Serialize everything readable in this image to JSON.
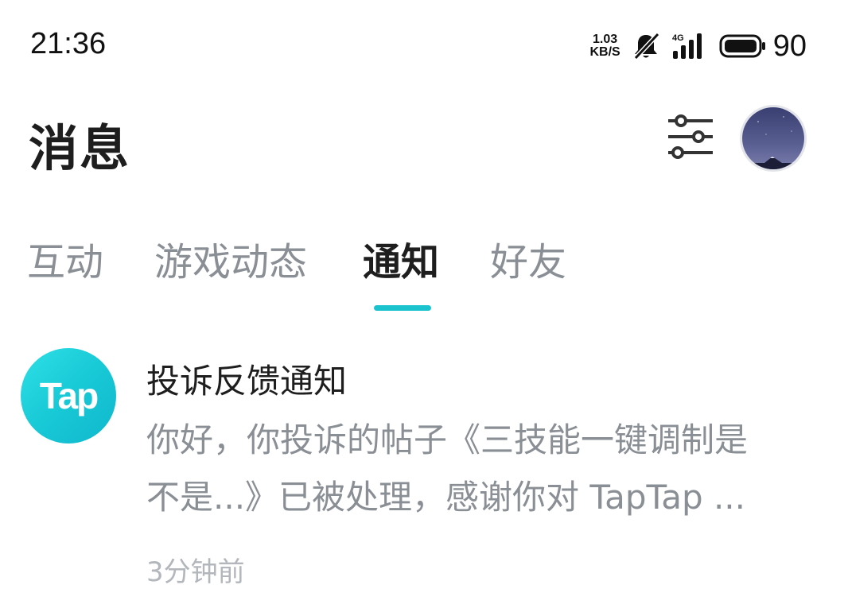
{
  "status_bar": {
    "time": "21:36",
    "net_speed_value": "1.03",
    "net_speed_unit": "KB/S",
    "network_type": "4G",
    "battery_level": "90",
    "icons": [
      "bell-muted-icon",
      "signal-icon",
      "battery-icon"
    ]
  },
  "header": {
    "title": "消息",
    "filter_icon": "sliders-icon",
    "avatar_icon": "user-avatar"
  },
  "tabs": {
    "items": [
      {
        "label": "互动"
      },
      {
        "label": "游戏动态"
      },
      {
        "label": "通知"
      },
      {
        "label": "好友"
      }
    ],
    "active_index": 2,
    "accent_color": "#1bc3cf"
  },
  "notifications": [
    {
      "sender_logo_text": "Tap",
      "title": "投诉反馈通知",
      "body_line_1": "你好，你投诉的帖子《三技能一键调制是",
      "body_line_2": "不是...》已被处理，感谢你对 TapTap ...",
      "time": "3分钟前"
    }
  ],
  "colors": {
    "logo_gradient_start": "#2ee0e6",
    "logo_gradient_end": "#0fb7cc",
    "text_primary": "#1e1e1e",
    "text_secondary": "#8a8f95",
    "text_tertiary": "#b3b7bc"
  }
}
